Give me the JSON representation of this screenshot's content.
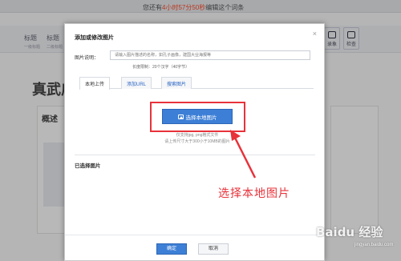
{
  "background": {
    "notice_prefix": "您还有",
    "notice_time": "4小时57分50秒",
    "notice_suffix": "编辑这个词条",
    "toolbar_items": [
      {
        "label": "标题",
        "sub": "一级标题"
      },
      {
        "label": "标题",
        "sub": "二级标题"
      }
    ],
    "right_buttons": [
      "录象",
      "检查"
    ],
    "entry_title": "真武庙",
    "summary_tab": "概述"
  },
  "dialog": {
    "title": "添加或修改图片",
    "close": "×",
    "caption_label": "图片说明：",
    "caption_placeholder": "请输入图片描述的名称，如孔子画像，建国大业海报等",
    "length_hint": "长度限制：20个汉字（40字节）",
    "tabs": [
      "本地上传",
      "添加URL",
      "搜索图片"
    ],
    "upload_button": "选择本地图片",
    "support_hint_line1": "仅支持jpg, png格式文件",
    "support_hint_line2": "请上传尺寸大于300小于10MB的图片",
    "selected_heading": "已选择图片",
    "ok_button": "确定",
    "cancel_button": "取消"
  },
  "annotation": {
    "text": "选择本地图片",
    "color": "#e8323a"
  },
  "watermark": {
    "text": "Baidu 经验",
    "sub": "jingyan.baidu.com"
  }
}
